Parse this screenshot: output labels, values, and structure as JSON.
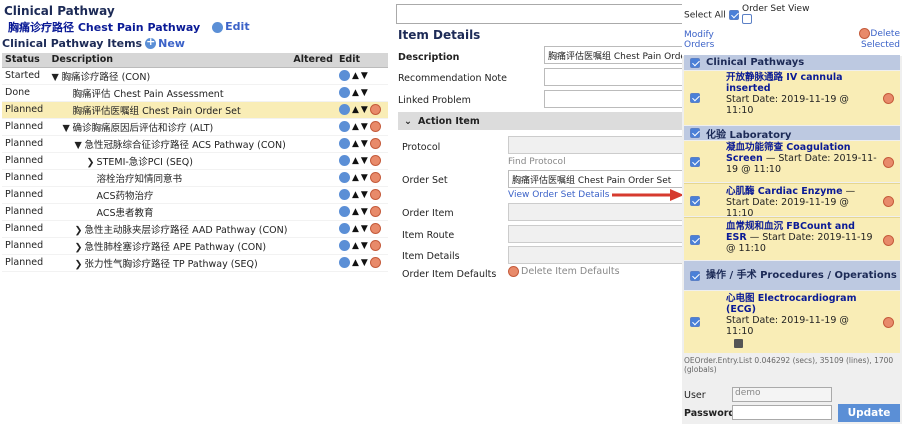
{
  "left": {
    "title": "Clinical Pathway",
    "pathway_name": "胸痛诊疗路径 Chest Pain Pathway",
    "edit_label": "Edit",
    "items_title": "Clinical Pathway Items",
    "new_label": "New",
    "columns": [
      "Status",
      "Description",
      "Altered",
      "Edit"
    ],
    "rows": [
      {
        "status": "Started",
        "desc": "胸痛诊疗路径 (CON)"
      },
      {
        "status": "Done",
        "desc": "胸痛评估 Chest Pain Assessment"
      },
      {
        "status": "Planned",
        "desc": "胸痛评估医嘱组 Chest Pain Order Set"
      },
      {
        "status": "Planned",
        "desc": "确诊胸痛原因后评估和诊疗 (ALT)"
      },
      {
        "status": "Planned",
        "desc": "急性冠脉综合征诊疗路径 ACS Pathway (CON)"
      },
      {
        "status": "Planned",
        "desc": "STEMI-急诊PCI (SEQ)"
      },
      {
        "status": "Planned",
        "desc": "溶栓治疗知情同意书"
      },
      {
        "status": "Planned",
        "desc": "ACS药物治疗"
      },
      {
        "status": "Planned",
        "desc": "ACS患者教育"
      },
      {
        "status": "Planned",
        "desc": "急性主动脉夹层诊疗路径 AAD Pathway (CON)"
      },
      {
        "status": "Planned",
        "desc": "急性肺栓塞诊疗路径 APE Pathway (CON)"
      },
      {
        "status": "Planned",
        "desc": "张力性气胸诊疗路径 TP Pathway (SEQ)"
      }
    ]
  },
  "middle": {
    "title": "Item Details",
    "description_label": "Description",
    "description_value": "胸痛评估医嘱组 Chest Pain Order S",
    "recommendation_label": "Recommendation Note",
    "linked_label": "Linked Problem",
    "action_item_label": "Action Item",
    "protocol_label": "Protocol",
    "find_protocol": "Find Protocol",
    "order_set_label": "Order Set",
    "order_set_value": "胸痛评估医嘱组 Chest Pain Order Set",
    "view_order_set": "View Order Set Details",
    "order_item_label": "Order Item",
    "item_route_label": "Item Route",
    "item_details_label": "Item Details",
    "order_item_defaults_label": "Order Item Defaults",
    "delete_item_defaults": "Delete Item Defaults"
  },
  "right": {
    "select_all": "Select All",
    "order_set_view": "Order Set View",
    "modify_orders": "Modify Orders",
    "delete_selected": "Delete Selected",
    "cat1": "Clinical Pathways",
    "ord1_name": "开放静脉通路 IV cannula inserted",
    "ord1_date": "Start Date: 2019-11-19 @ 11:10",
    "cat2": "化验 Laboratory",
    "ord2_name": "凝血功能筛查 Coagulation Screen",
    "ord2_date": "— Start Date: 2019-11-19 @ 11:10",
    "ord3_name": "心肌酶 Cardiac Enzyme",
    "ord3_date": "— Start Date: 2019-11-19 @ 11:10",
    "ord4_name": "血常规和血沉 FBCount and ESR",
    "ord4_date": "— Start Date: 2019-11-19 @ 11:10",
    "cat3": "操作 / 手术 Procedures / Operations",
    "ord5_name": "心电图 Electrocardiogram (ECG)",
    "ord5_date": "Start Date: 2019-11-19 @ 11:10",
    "stats": "OEOrder.Entry.List  0.046292 (secs),  35109 (lines), 1700 (globals)",
    "user_label": "User",
    "user_value": "demo",
    "password_label": "Password",
    "update_label": "Update"
  },
  "colors": {
    "highlight": "#f9edb6",
    "category": "#bdc9e1",
    "link": "#3b62c8",
    "accent": "#5b8fd6"
  }
}
